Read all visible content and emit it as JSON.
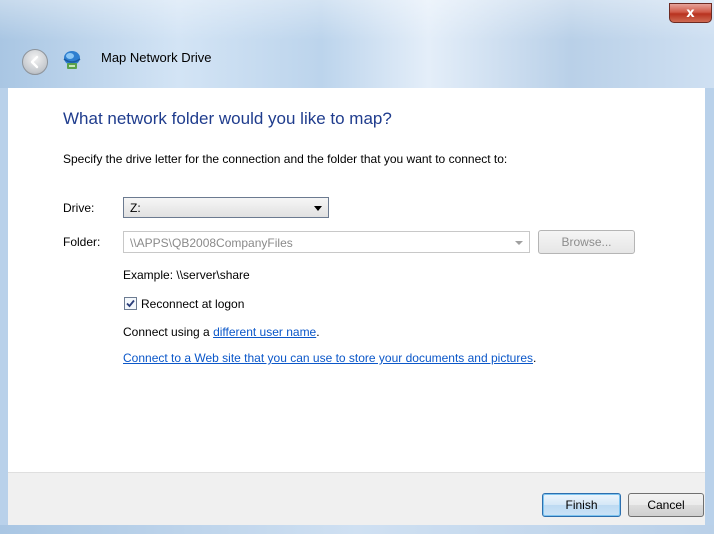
{
  "window": {
    "title": "Map Network Drive",
    "close_glyph": "x"
  },
  "content": {
    "heading": "What network folder would you like to map?",
    "instruction": "Specify the drive letter for the connection and the folder that you want to connect to:",
    "drive": {
      "label": "Drive:",
      "value": "Z:"
    },
    "folder": {
      "label": "Folder:",
      "value": "\\\\APPS\\QB2008CompanyFiles",
      "browse_label": "Browse..."
    },
    "example": "Example: \\\\server\\share",
    "reconnect": {
      "label": "Reconnect at logon",
      "checked": true
    },
    "connect_prefix": "Connect using a ",
    "connect_link": "different user name",
    "connect_suffix": ".",
    "web_link": "Connect to a Web site that you can use to store your documents and pictures",
    "web_suffix": "."
  },
  "buttons": {
    "finish": "Finish",
    "cancel": "Cancel"
  },
  "icons": {
    "back": "back-arrow-icon",
    "network": "network-drive-icon",
    "close": "close-icon"
  }
}
